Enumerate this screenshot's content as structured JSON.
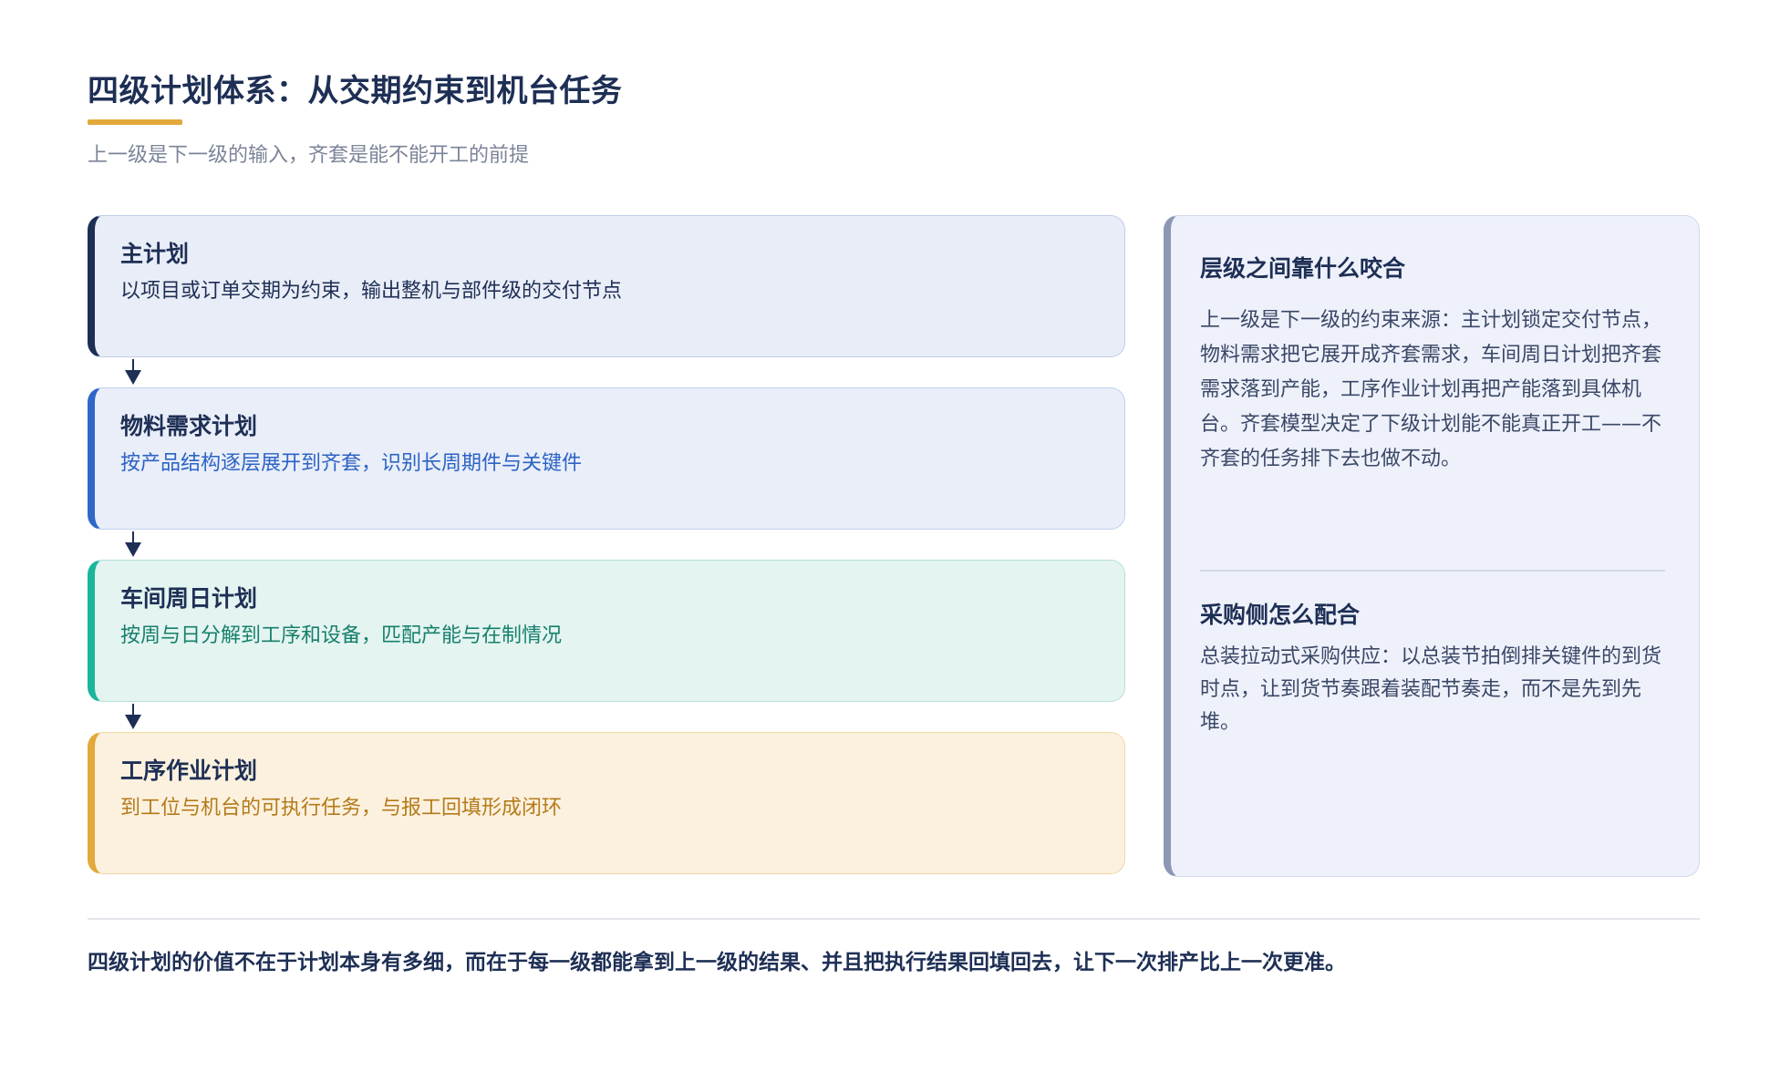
{
  "header": {
    "title": "四级计划体系：从交期约束到机台任务",
    "subtitle": "上一级是下一级的输入，齐套是能不能开工的前提"
  },
  "levels": [
    {
      "name": "主计划",
      "desc": "以项目或订单交期为约束，输出整机与部件级的交付节点"
    },
    {
      "name": "物料需求计划",
      "desc": "按产品结构逐层展开到齐套，识别长周期件与关键件"
    },
    {
      "name": "车间周日计划",
      "desc": "按周与日分解到工序和设备，匹配产能与在制情况"
    },
    {
      "name": "工序作业计划",
      "desc": "到工位与机台的可执行任务，与报工回填形成闭环"
    }
  ],
  "side_panel": {
    "section1": {
      "heading": "层级之间靠什么咬合",
      "text": "上一级是下一级的约束来源：主计划锁定交付节点，物料需求把它展开成齐套需求，车间周日计划把齐套需求落到产能，工序作业计划再把产能落到具体机台。齐套模型决定了下级计划能不能真正开工——不齐套的任务排下去也做不动。"
    },
    "section2": {
      "heading": "采购侧怎么配合",
      "text": "总装拉动式采购供应：以总装节拍倒排关键件的到货时点，让到货节奏跟着装配节奏走，而不是先到先堆。"
    }
  },
  "footer": {
    "text": "四级计划的价值不在于计划本身有多细，而在于每一级都能拿到上一级的结果、并且把执行结果回填回去，让下一次排产比上一次更准。"
  },
  "colors": {
    "navy": "#1e2f55",
    "blue": "#2f67c8",
    "teal": "#1ab59a",
    "amber": "#e2a93b",
    "slate": "#8c97b4"
  }
}
